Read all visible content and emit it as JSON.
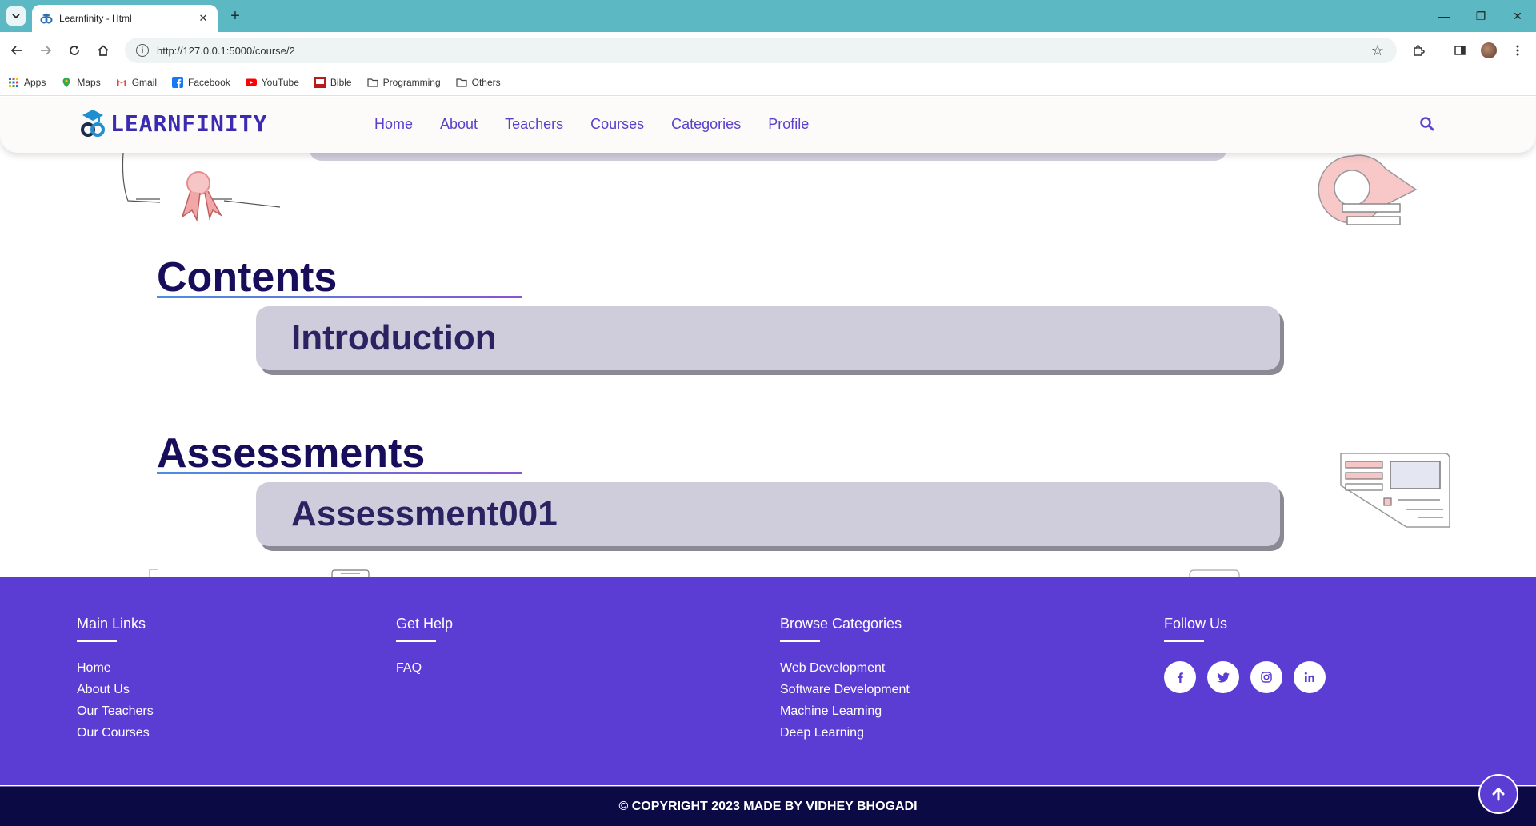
{
  "browser": {
    "tab_title": "Learnfinity - Html",
    "url": "http://127.0.0.1:5000/course/2",
    "bookmarks": [
      {
        "label": "Apps",
        "icon": "apps-grid-icon"
      },
      {
        "label": "Maps",
        "icon": "maps-pin-icon"
      },
      {
        "label": "Gmail",
        "icon": "gmail-icon"
      },
      {
        "label": "Facebook",
        "icon": "facebook-icon"
      },
      {
        "label": "YouTube",
        "icon": "youtube-icon"
      },
      {
        "label": "Bible",
        "icon": "bible-icon"
      },
      {
        "label": "Programming",
        "icon": "folder-icon"
      },
      {
        "label": "Others",
        "icon": "folder-icon"
      }
    ]
  },
  "site": {
    "brand": "LEARNFINITY",
    "nav": [
      "Home",
      "About",
      "Teachers",
      "Courses",
      "Categories",
      "Profile"
    ]
  },
  "content": {
    "contents_title": "Contents",
    "contents_items": [
      "Introduction"
    ],
    "assessments_title": "Assessments",
    "assessment_items": [
      "Assessment001"
    ]
  },
  "footer": {
    "main_links_title": "Main Links",
    "main_links": [
      "Home",
      "About Us",
      "Our Teachers",
      "Our Courses"
    ],
    "help_title": "Get Help",
    "help_links": [
      "FAQ"
    ],
    "categories_title": "Browse Categories",
    "categories": [
      "Web Development",
      "Software Development",
      "Machine Learning",
      "Deep Learning"
    ],
    "follow_title": "Follow Us",
    "socials": [
      "facebook-icon",
      "twitter-icon",
      "instagram-icon",
      "linkedin-icon"
    ],
    "copyright": "© COPYRIGHT 2023 MADE BY VIDHEY BHOGADI"
  },
  "colors": {
    "accent": "#5c3dd4",
    "dark": "#0b0a44",
    "card": "#cfcddb",
    "chrome": "#5cb8c2"
  }
}
